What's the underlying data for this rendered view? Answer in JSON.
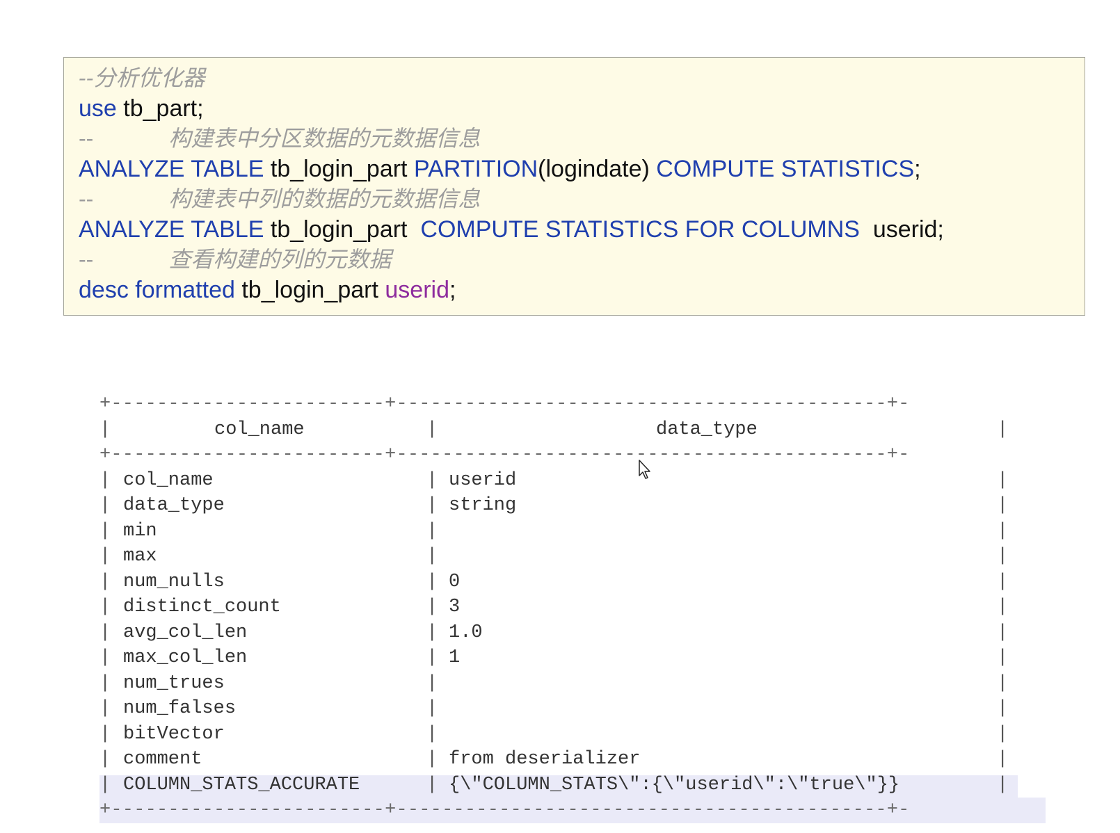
{
  "code": {
    "comment_title": "--分析优化器",
    "line_use": {
      "kw": "use",
      "rest": " tb_part;"
    },
    "comment_1": {
      "dash": "--",
      "text": "构建表中分区数据的元数据信息"
    },
    "line_analyze_partition": {
      "kw1": "ANALYZE TABLE",
      "t1": " tb_login_part ",
      "kw2": "PARTITION",
      "t2": "(logindate) ",
      "kw3": "COMPUTE STATISTICS",
      "t3": ";"
    },
    "comment_2": {
      "dash": "--",
      "text": "构建表中列的数据的元数据信息"
    },
    "line_analyze_columns": {
      "kw1": "ANALYZE TABLE",
      "t1": " tb_login_part  ",
      "kw2": "COMPUTE STATISTICS FOR COLUMNS",
      "t2": "  userid;"
    },
    "comment_3": {
      "dash": "--",
      "text": "查看构建的列的元数据"
    },
    "line_desc": {
      "kw": "desc formatted",
      "t1": " tb_login_part ",
      "fn": "userid",
      "t2": ";"
    }
  },
  "table": {
    "border": "+------------------------+-------------------------------------------+-",
    "header": {
      "col1": "col_name",
      "col2": "data_type"
    },
    "rows": [
      {
        "name": "col_name",
        "value": "userid"
      },
      {
        "name": "data_type",
        "value": "string"
      },
      {
        "name": "min",
        "value": ""
      },
      {
        "name": "max",
        "value": ""
      },
      {
        "name": "num_nulls",
        "value": "0"
      },
      {
        "name": "distinct_count",
        "value": "3"
      },
      {
        "name": "avg_col_len",
        "value": "1.0"
      },
      {
        "name": "max_col_len",
        "value": "1"
      },
      {
        "name": "num_trues",
        "value": ""
      },
      {
        "name": "num_falses",
        "value": ""
      },
      {
        "name": "bitVector",
        "value": ""
      },
      {
        "name": "comment",
        "value": "from deserializer"
      },
      {
        "name": "COLUMN_STATS_ACCURATE",
        "value": "{\\\"COLUMN_STATS\\\":{\\\"userid\\\":\\\"true\\\"}}"
      }
    ]
  },
  "colors": {
    "code_background": "#fefbe6",
    "keyword": "#1f3fae",
    "comment": "#9d9d9d",
    "function": "#8e2c9e",
    "highlight_row": "#eaeaf8"
  },
  "icons": {
    "cursor": "mouse-pointer-icon"
  }
}
